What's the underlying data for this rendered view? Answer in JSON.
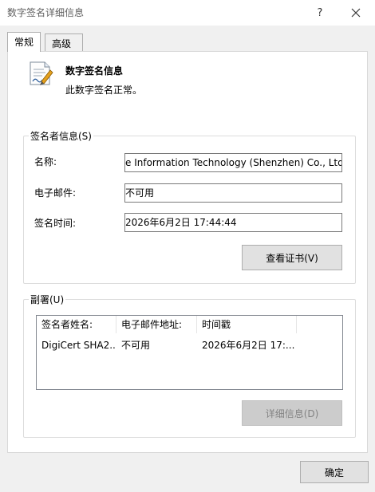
{
  "window": {
    "title": "数字签名详细信息",
    "help_glyph": "?"
  },
  "tabs": [
    {
      "label": "常规",
      "active": true
    },
    {
      "label": "高级",
      "active": false
    }
  ],
  "info": {
    "header": "数字签名信息",
    "status": "此数字签名正常。"
  },
  "signer": {
    "legend": "签名者信息(S)",
    "name_label": "名称:",
    "name_value": "e Information Technology (Shenzhen) Co., Ltd.",
    "email_label": "电子邮件:",
    "email_value": "不可用",
    "time_label": "签名时间:",
    "time_value": "2026年6月2日 17:44:44",
    "view_cert_button": "查看证书(V)"
  },
  "countersig": {
    "legend": "副署(U)",
    "columns": [
      "签名者姓名:",
      "电子邮件地址:",
      "时间戳"
    ],
    "rows": [
      [
        "DigiCert SHA2...",
        "不可用",
        "2026年6月2日 17:..."
      ]
    ],
    "details_button": "详细信息(D)"
  },
  "footer": {
    "ok_button": "确定"
  },
  "icons": {
    "certificate": "certificate-pen-icon",
    "close": "close-icon"
  }
}
